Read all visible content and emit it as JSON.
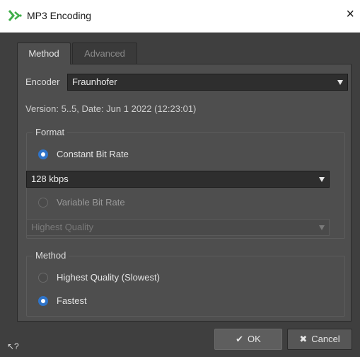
{
  "window": {
    "title": "MP3 Encoding",
    "close_glyph": "×",
    "app_icon": "wavelab-logo-icon"
  },
  "tabs": [
    {
      "label": "Method",
      "active": true
    },
    {
      "label": "Advanced",
      "active": false
    }
  ],
  "encoder": {
    "label": "Encoder",
    "value": "Fraunhofer"
  },
  "version_text": "Version: 5..5, Date: Jun  1 2022 (12:23:01)",
  "format": {
    "title": "Format",
    "cbr_label": "Constant Bit Rate",
    "cbr_selected": true,
    "cbr_value": "128 kbps",
    "vbr_label": "Variable Bit Rate",
    "vbr_selected": false,
    "vbr_value": "Highest Quality"
  },
  "method": {
    "title": "Method",
    "options": [
      {
        "label": "Highest Quality (Slowest)",
        "selected": false
      },
      {
        "label": "Fastest",
        "selected": true
      }
    ]
  },
  "buttons": {
    "ok": "OK",
    "cancel": "Cancel",
    "ok_glyph": "✔",
    "cancel_glyph": "✖"
  },
  "help_glyph": "↖?",
  "colors": {
    "accent": "#2f74c9",
    "panel": "#4e4e4e",
    "app_icon_green": "#3fae49"
  }
}
